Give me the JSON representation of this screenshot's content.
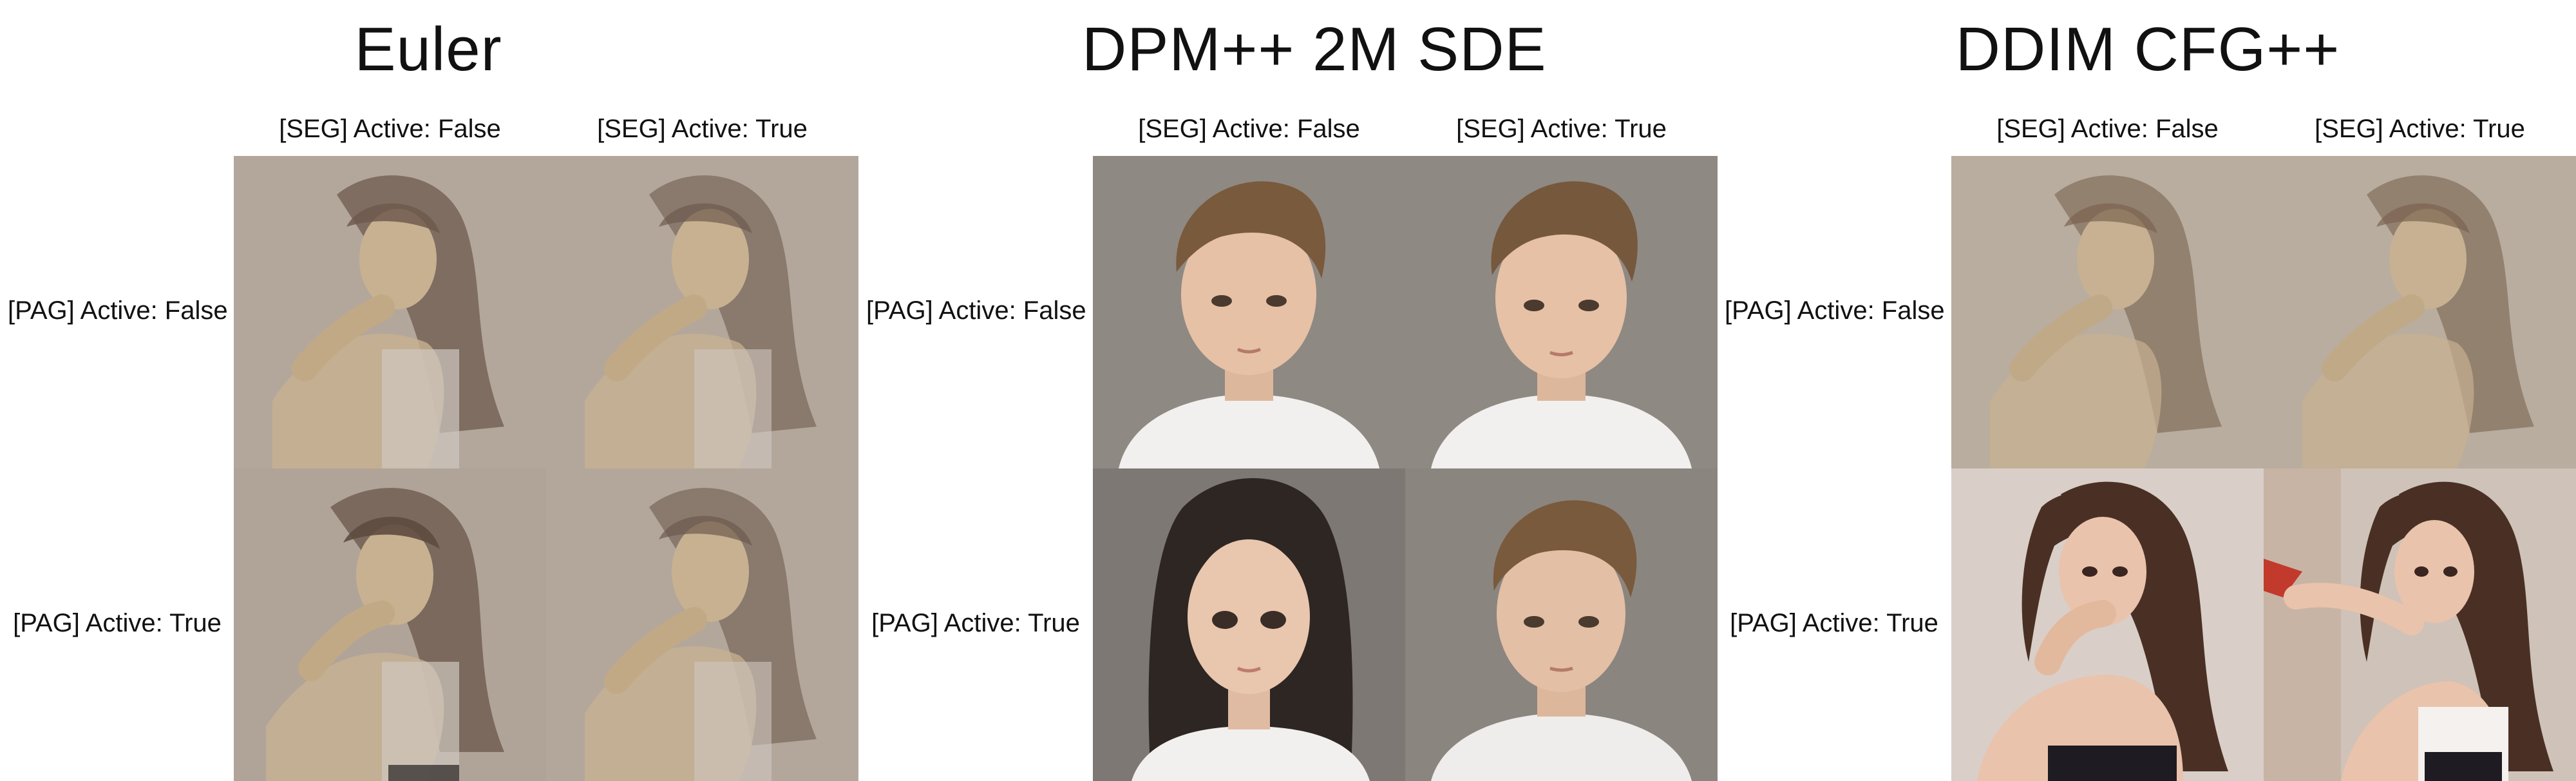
{
  "panels": [
    {
      "title": "Euler",
      "col_labels": [
        "[SEG] Active: False",
        "[SEG] Active: True"
      ],
      "row_labels": [
        "[PAG] Active: False",
        "[PAG] Active: True"
      ]
    },
    {
      "title": "DPM++ 2M SDE",
      "col_labels": [
        "[SEG] Active: False",
        "[SEG] Active: True"
      ],
      "row_labels": [
        "[PAG] Active: False",
        "[PAG] Active: True"
      ]
    },
    {
      "title": "DDIM CFG++",
      "col_labels": [
        "[SEG] Active: False",
        "[SEG] Active: True"
      ],
      "row_labels": [
        "[PAG] Active: False",
        "[PAG] Active: True"
      ]
    }
  ],
  "colors": {
    "washed_bg": "#b3a79c",
    "washed_skin": "#c8b191",
    "washed_hair": "#6e5a4e",
    "gray_bg": "#8f8983",
    "boy_hair": "#7a5a3c",
    "skin": "#e6c1a6",
    "shirt": "#f2f0ee",
    "dark_hair": "#2e2622",
    "photo_bg": "#d9cec8",
    "photo_hair": "#4a3024",
    "photo_skin": "#e9c3ab"
  },
  "image_content": [
    [
      "washed-girl",
      "washed-girl",
      "washed-girl",
      "washed-girl"
    ],
    [
      "boy",
      "boy",
      "girl-dark-hair",
      "boy"
    ],
    [
      "washed-girl",
      "washed-girl",
      "photo-girl",
      "photo-girl"
    ]
  ]
}
